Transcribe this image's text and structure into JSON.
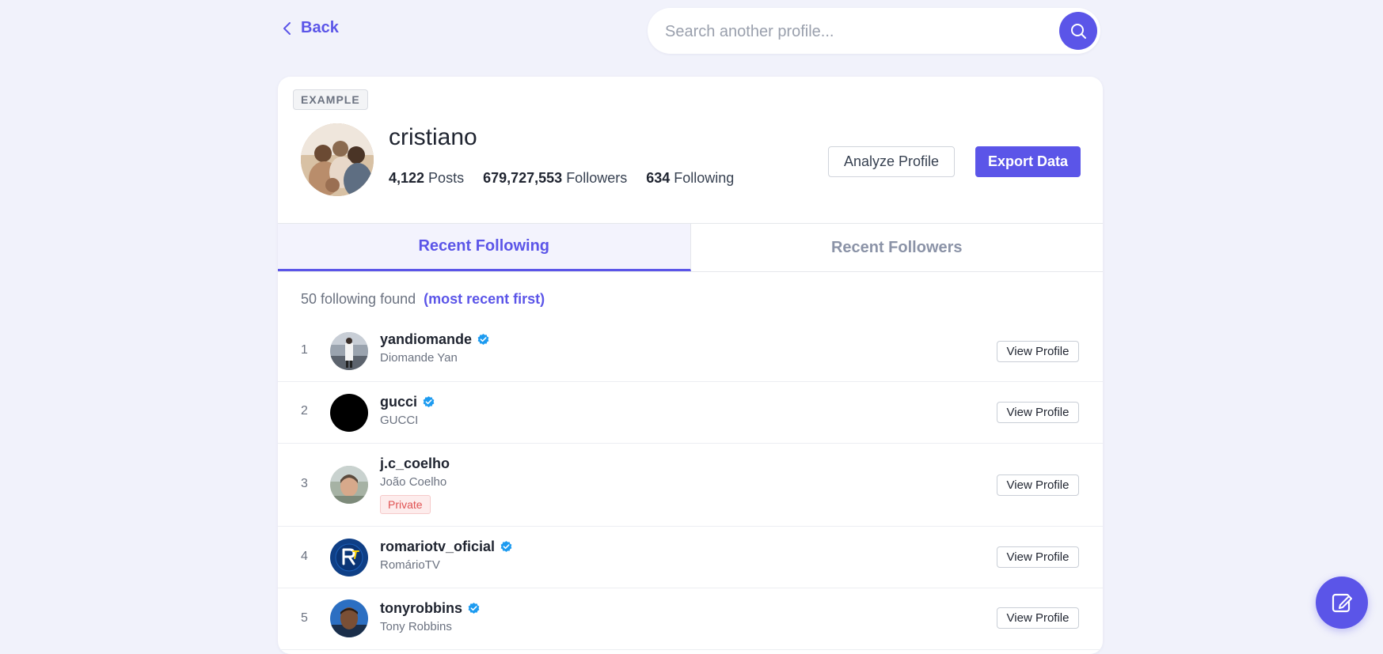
{
  "nav": {
    "back_label": "Back"
  },
  "search": {
    "placeholder": "Search another profile..."
  },
  "profile": {
    "badge": "EXAMPLE",
    "username": "cristiano",
    "stats": [
      {
        "value": "4,122",
        "label": "Posts"
      },
      {
        "value": "679,727,553",
        "label": "Followers"
      },
      {
        "value": "634",
        "label": "Following"
      }
    ],
    "analyze_label": "Analyze Profile",
    "export_label": "Export Data"
  },
  "tabs": [
    {
      "label": "Recent Following",
      "active": true
    },
    {
      "label": "Recent Followers",
      "active": false
    }
  ],
  "results": {
    "count_text": "50 following found",
    "sort_note": "(most recent first)"
  },
  "list": {
    "view_label": "View Profile",
    "private_label": "Private",
    "items": [
      {
        "index": "1",
        "username": "yandiomande",
        "fullname": "Diomande Yan",
        "verified": true,
        "private": false
      },
      {
        "index": "2",
        "username": "gucci",
        "fullname": "GUCCI",
        "verified": true,
        "private": false
      },
      {
        "index": "3",
        "username": "j.c_coelho",
        "fullname": "João Coelho",
        "verified": false,
        "private": true
      },
      {
        "index": "4",
        "username": "romariotv_oficial",
        "fullname": "RomárioTV",
        "verified": true,
        "private": false
      },
      {
        "index": "5",
        "username": "tonyrobbins",
        "fullname": "Tony Robbins",
        "verified": true,
        "private": false
      }
    ]
  },
  "colors": {
    "accent": "#5b55e8",
    "verified": "#1d9bf0",
    "private_text": "#e05252",
    "background": "#f1f2fb"
  },
  "icons": {
    "back": "chevron-left-icon",
    "search": "search-icon",
    "verified": "verified-badge-icon",
    "fab": "edit-note-icon"
  }
}
